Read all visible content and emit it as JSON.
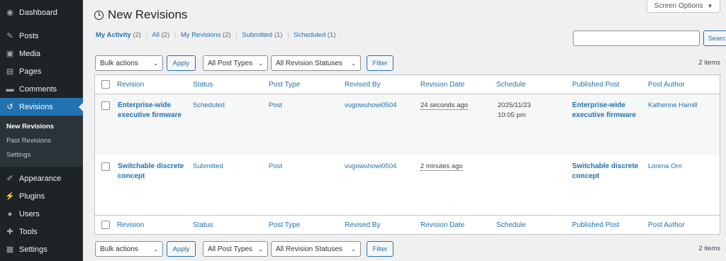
{
  "sidebar": {
    "items": [
      {
        "label": "Dashboard",
        "icon": "dashboard-icon"
      },
      {
        "label": "Posts",
        "icon": "pin-icon"
      },
      {
        "label": "Media",
        "icon": "media-icon"
      },
      {
        "label": "Pages",
        "icon": "pages-icon"
      },
      {
        "label": "Comments",
        "icon": "comment-icon"
      },
      {
        "label": "Revisions",
        "icon": "history-icon"
      },
      {
        "label": "Appearance",
        "icon": "brush-icon"
      },
      {
        "label": "Plugins",
        "icon": "plug-icon"
      },
      {
        "label": "Users",
        "icon": "user-icon"
      },
      {
        "label": "Tools",
        "icon": "wrench-icon"
      },
      {
        "label": "Settings",
        "icon": "settings-icon"
      }
    ],
    "submenu": [
      "New Revisions",
      "Past Revisions",
      "Settings"
    ]
  },
  "screen_options": "Screen Options",
  "page_title": "New Revisions",
  "views": [
    {
      "label": "My Activity",
      "count": "(2)"
    },
    {
      "label": "All",
      "count": "(2)"
    },
    {
      "label": "My Revisions",
      "count": "(2)"
    },
    {
      "label": "Submitted",
      "count": "(1)"
    },
    {
      "label": "Scheduled",
      "count": "(1)"
    }
  ],
  "search": {
    "button": "Search"
  },
  "tablenav": {
    "bulk": "Bulk actions",
    "apply": "Apply",
    "post_types": "All Post Types",
    "statuses": "All Revision Statuses",
    "filter": "Filter",
    "items": "2 items"
  },
  "columns": [
    "Revision",
    "Status",
    "Post Type",
    "Revised By",
    "Revision Date",
    "Schedule",
    "Published Post",
    "Post Author"
  ],
  "rows": [
    {
      "revision": "Enterprise-wide executive firmware",
      "status": "Scheduled",
      "post_type": "Post",
      "revised_by": "vugowuhowi0504",
      "revision_date": "24 seconds ago",
      "schedule": "2025/11/23",
      "schedule_time": "10:05 pm",
      "published_post": "Enterprise-wide executive firmware",
      "author": "Katherine Hamill"
    },
    {
      "revision": "Switchable discrete concept",
      "status": "Submitted",
      "post_type": "Post",
      "revised_by": "vugowuhowi0504",
      "revision_date": "2 minutes ago",
      "schedule": "",
      "schedule_time": "",
      "published_post": "Switchable discrete concept",
      "author": "Lorena Orn"
    }
  ],
  "colors": {
    "accent": "#2271b1",
    "sidebar": "#1d2327",
    "submenu": "#2c3338",
    "page_bg": "#f0f0f1"
  }
}
